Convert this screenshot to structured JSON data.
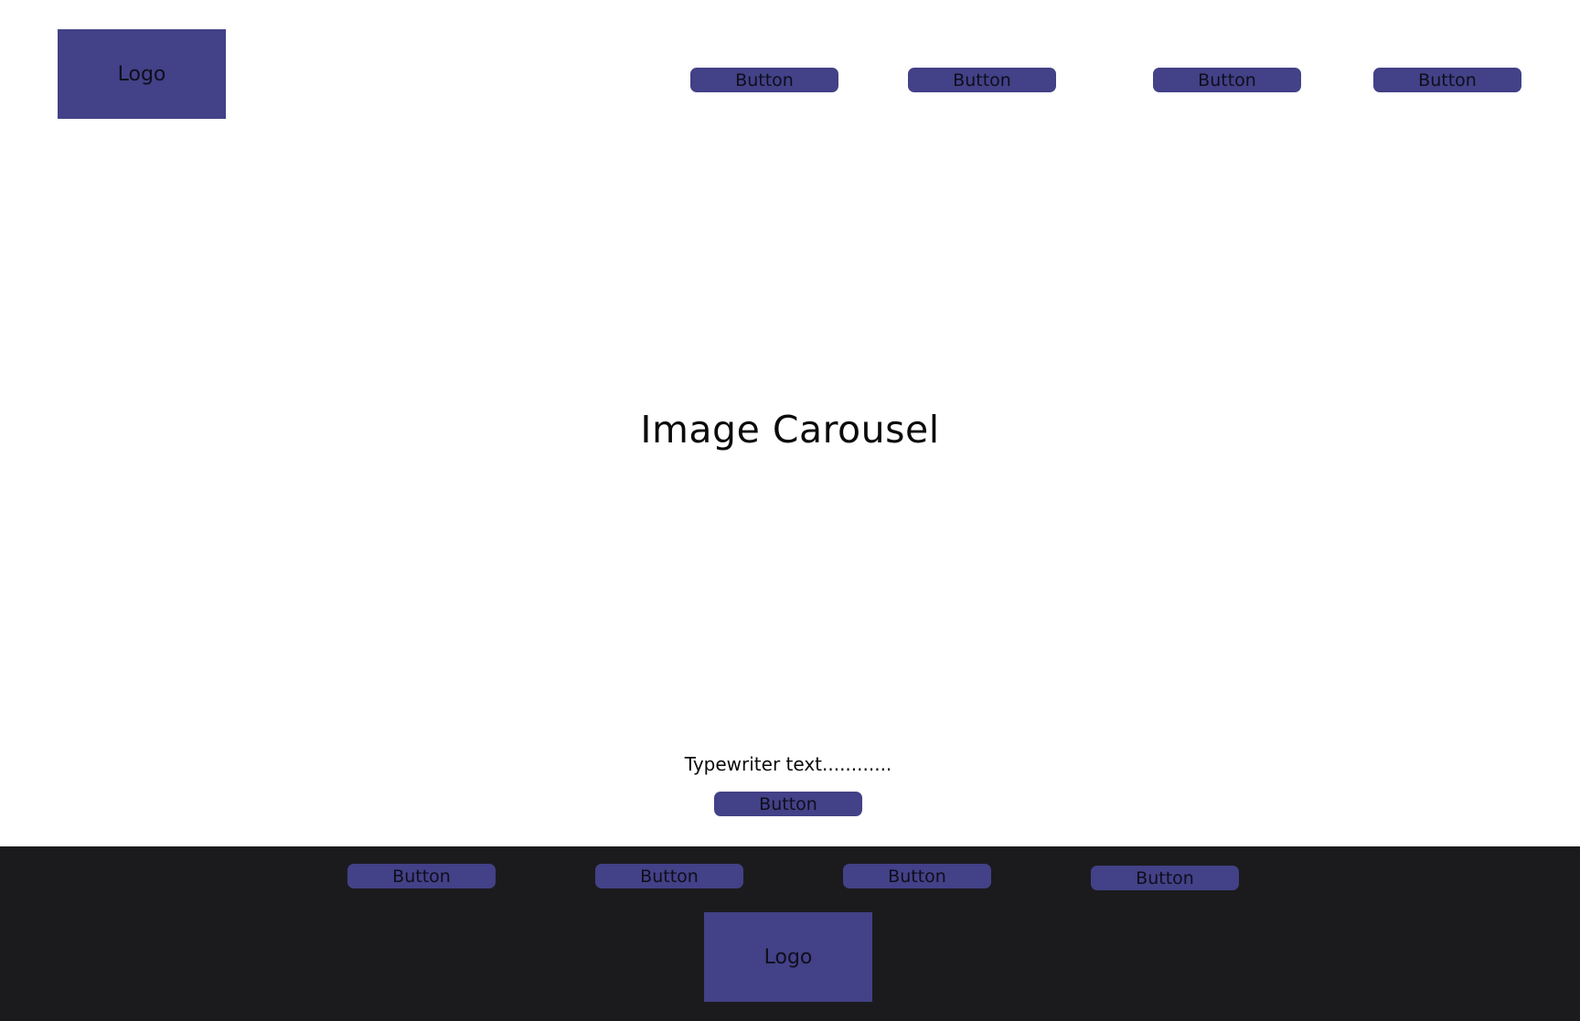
{
  "colors": {
    "accent": "#434187",
    "footer_bg": "#1b1b1e",
    "page_bg": "#ffffff"
  },
  "header": {
    "logo": "Logo",
    "nav_buttons": [
      "Button",
      "Button",
      "Button",
      "Button"
    ]
  },
  "hero": {
    "carousel_label": "Image Carousel",
    "typewriter_text": "Typewriter text............",
    "cta_label": "Button"
  },
  "footer": {
    "buttons": [
      "Button",
      "Button",
      "Button",
      "Button"
    ],
    "logo": "Logo"
  }
}
